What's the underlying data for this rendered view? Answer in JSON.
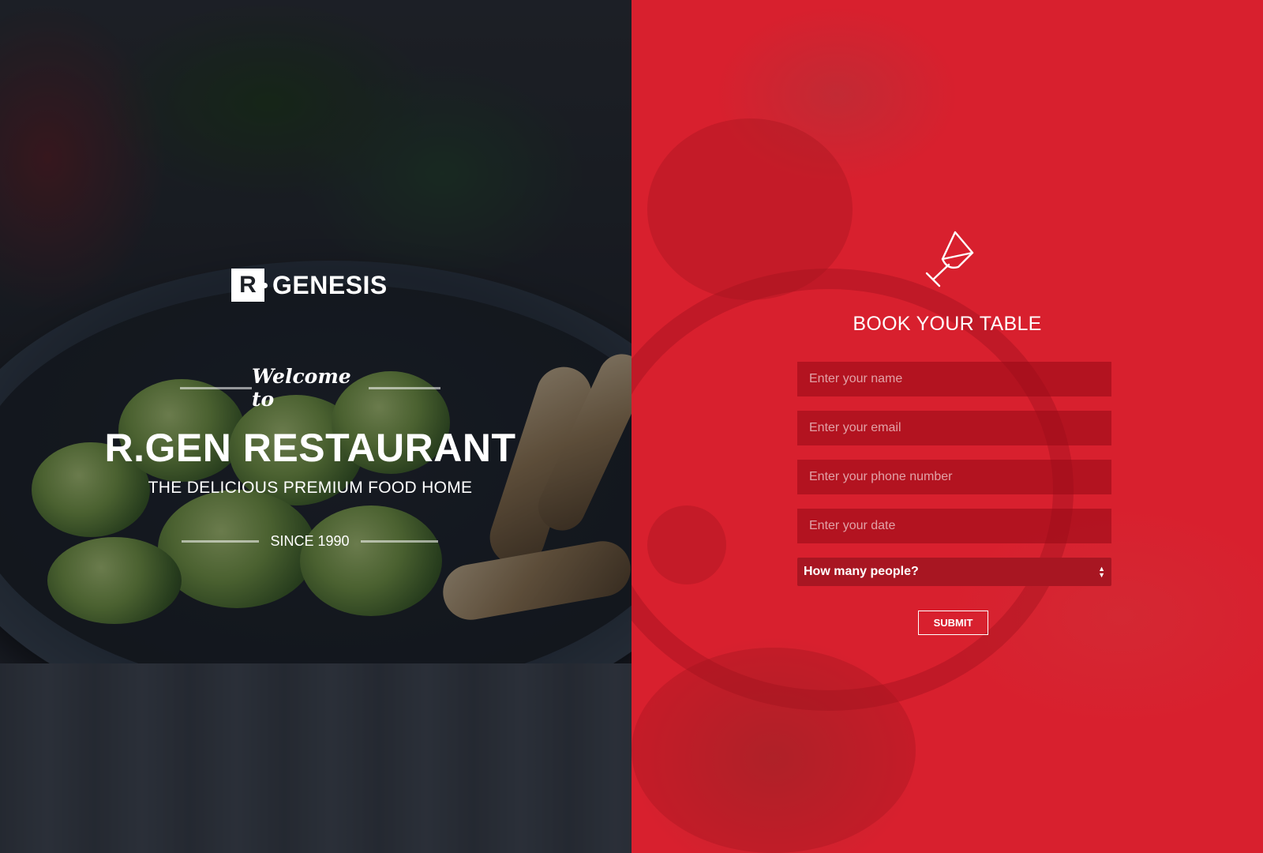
{
  "brand": {
    "logo_mark": "R",
    "logo_text": "GENESIS"
  },
  "hero": {
    "welcome": "Welcome to",
    "title": "R.GEN RESTAURANT",
    "subtitle": "THE DELICIOUS PREMIUM FOOD HOME",
    "since": "SINCE 1990"
  },
  "booking": {
    "icon": "wine-glass-icon",
    "title": "BOOK YOUR TABLE",
    "name_placeholder": "Enter your name",
    "email_placeholder": "Enter your email",
    "phone_placeholder": "Enter your phone number",
    "date_placeholder": "Enter your date",
    "people_select": "How many people?",
    "submit_label": "SUBMIT"
  },
  "colors": {
    "accent_red": "#d8202e",
    "field_bg": "#a81622",
    "text": "#ffffff"
  }
}
